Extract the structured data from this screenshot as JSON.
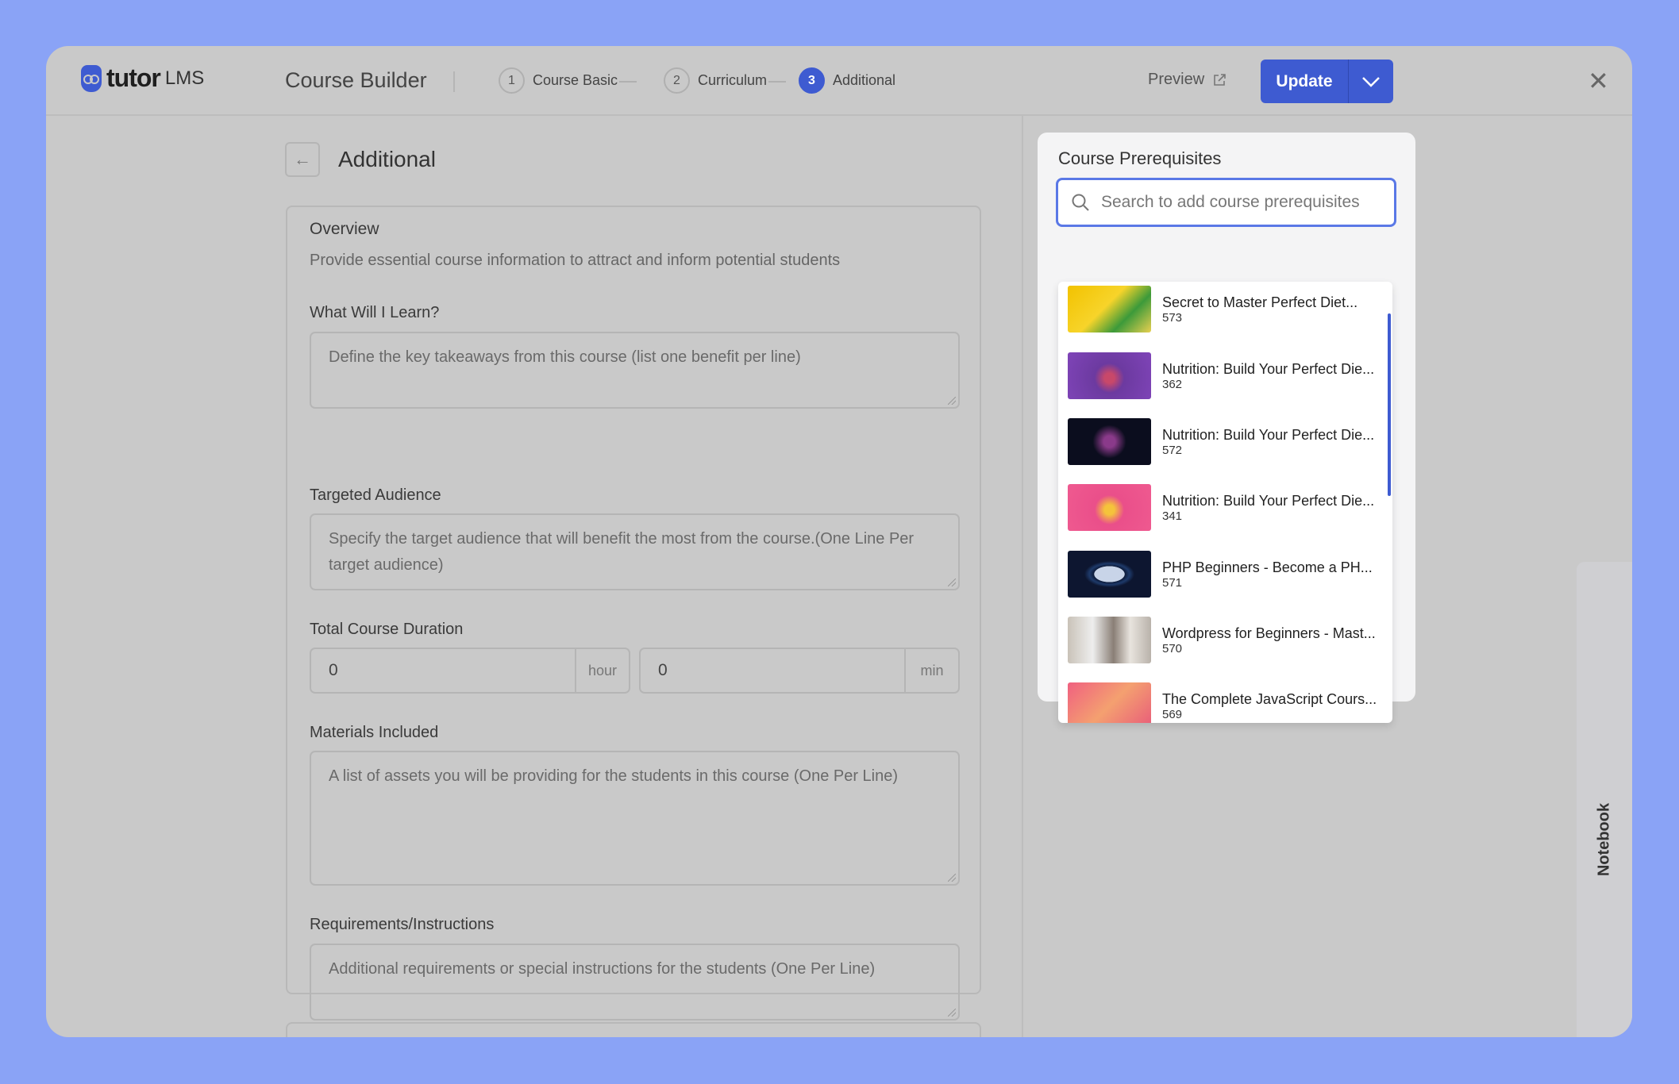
{
  "header": {
    "logo_text": "tutor",
    "logo_suffix": "LMS",
    "title": "Course Builder",
    "steps": [
      {
        "num": "1",
        "label": "Course Basic"
      },
      {
        "num": "2",
        "label": "Curriculum"
      },
      {
        "num": "3",
        "label": "Additional",
        "active": true
      }
    ],
    "preview_label": "Preview",
    "update_label": "Update"
  },
  "page": {
    "title": "Additional"
  },
  "overview": {
    "title": "Overview",
    "description": "Provide essential course information to attract and inform potential students",
    "learn_label": "What Will I Learn?",
    "learn_placeholder": "Define the key takeaways from this course (list one benefit per line)",
    "audience_label": "Targeted Audience",
    "audience_placeholder": "Specify the target audience that will benefit the most from the course.(One Line Per target audience)",
    "duration_label": "Total Course Duration",
    "hours_value": "0",
    "hours_unit": "hour",
    "minutes_value": "0",
    "minutes_unit": "min",
    "materials_label": "Materials Included",
    "materials_placeholder": "A list of assets you will be providing for the students in this course (One Per Line)",
    "requirements_label": "Requirements/Instructions",
    "requirements_placeholder": "Additional requirements or special instructions for the students (One Per Line)"
  },
  "prerequisites": {
    "title": "Course Prerequisites",
    "search_placeholder": "Search to add course prerequisites",
    "items": [
      {
        "title": "Secret to Master Perfect Diet...",
        "id": "573"
      },
      {
        "title": "Nutrition: Build Your Perfect Die...",
        "id": "362"
      },
      {
        "title": "Nutrition: Build Your Perfect Die...",
        "id": "572"
      },
      {
        "title": "Nutrition: Build Your Perfect Die...",
        "id": "341"
      },
      {
        "title": "PHP Beginners - Become a PH...",
        "id": "571"
      },
      {
        "title": "Wordpress for Beginners - Mast...",
        "id": "570"
      },
      {
        "title": "The Complete JavaScript Cours...",
        "id": "569"
      }
    ]
  },
  "notebook_label": "Notebook",
  "colors": {
    "background": "#8aa3f6",
    "accent": "#3e5bd1"
  }
}
